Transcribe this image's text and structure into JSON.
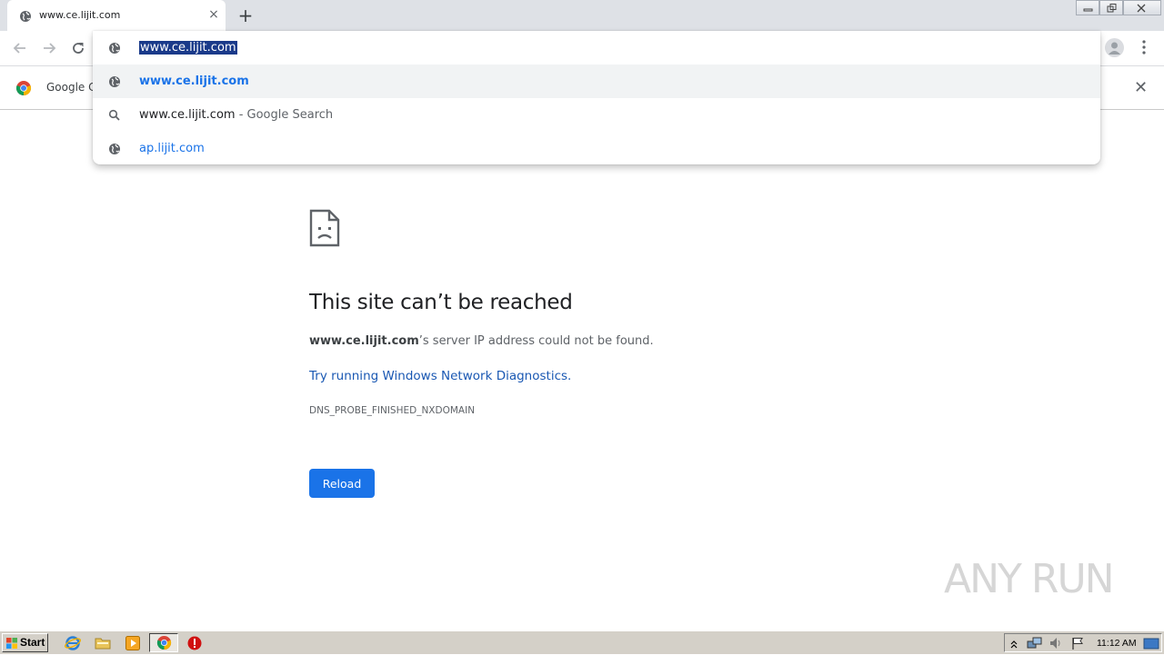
{
  "tab": {
    "title": "www.ce.lijit.com",
    "close_label": "×",
    "new_tab_label": "+"
  },
  "omnibox": {
    "input_value": "www.ce.lijit.com",
    "suggestions": [
      {
        "text": "www.ce.lijit.com",
        "icon": "globe-icon"
      },
      {
        "text": "www.ce.lijit.com",
        "suffix": " - Google Search",
        "icon": "search-icon"
      },
      {
        "text": "ap.lijit.com",
        "icon": "globe-icon"
      }
    ]
  },
  "infobar": {
    "text": "Google Cl",
    "close_label": "✕"
  },
  "error": {
    "title": "This site can’t be reached",
    "domain": "www.ce.lijit.com",
    "message_suffix": "’s server IP address could not be found.",
    "link": "Try running Windows Network Diagnostics.",
    "code": "DNS_PROBE_FINISHED_NXDOMAIN",
    "reload_label": "Reload"
  },
  "watermark": "ANY RUN",
  "taskbar": {
    "start_label": "Start",
    "clock": "11:12 AM"
  },
  "colors": {
    "accent": "#1a73e8",
    "link": "#1a58b3",
    "tabstrip": "#dee1e6",
    "taskbar": "#d4d0c8"
  }
}
